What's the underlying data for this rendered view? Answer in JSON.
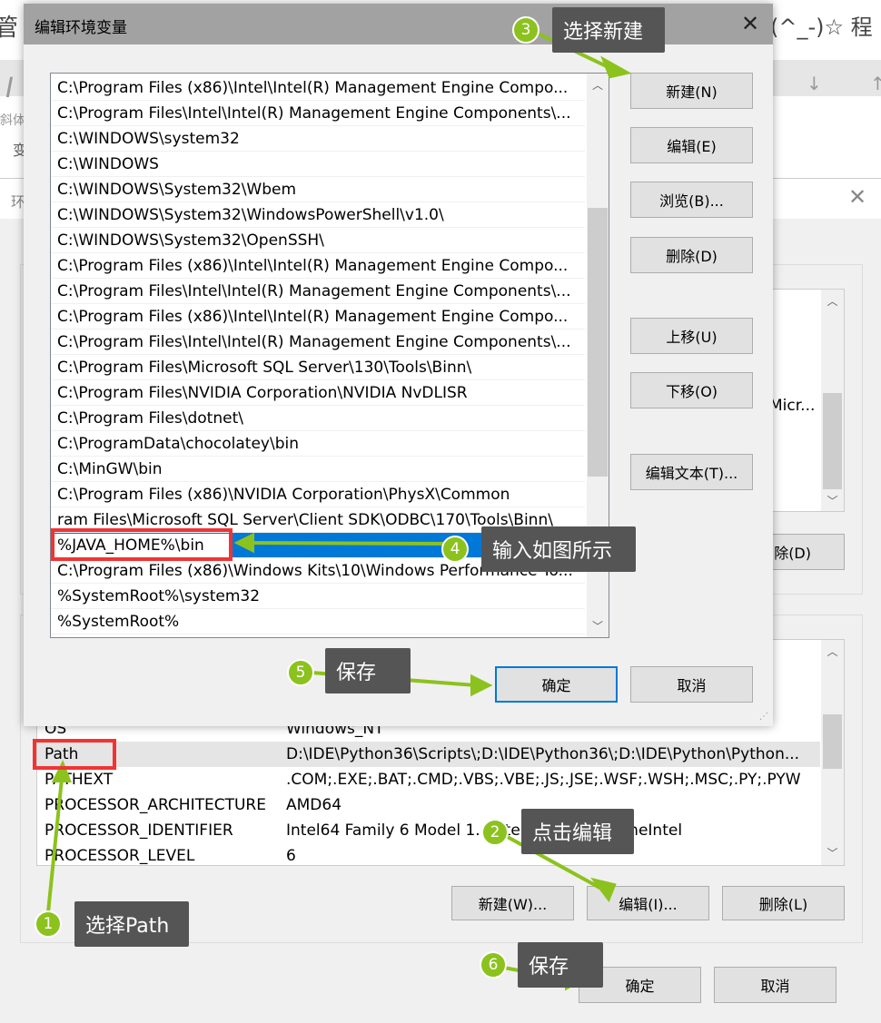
{
  "background": {
    "left_char": "管",
    "italic_char": "I",
    "italic_label": "斜体",
    "right_text": "(^_-)☆ 程",
    "side_char": "变"
  },
  "env_dialog": {
    "title_char": "环",
    "user_delete": "除(D)",
    "user_partial": "Micr...",
    "system_rows": [
      {
        "name": "OS",
        "value": "Windows_NT"
      },
      {
        "name": "Path",
        "value": "D:\\IDE\\Python36\\Scripts\\;D:\\IDE\\Python36\\;D:\\IDE\\Python\\Python..."
      },
      {
        "name": "PATHEXT",
        "value": ".COM;.EXE;.BAT;.CMD;.VBS;.VBE;.JS;.JSE;.WSF;.WSH;.MSC;.PY;.PYW"
      },
      {
        "name": "PROCESSOR_ARCHITECTURE",
        "value": "AMD64"
      },
      {
        "name": "PROCESSOR_IDENTIFIER",
        "value": "Intel64 Family 6 Model 1... Stepping... GenuineIntel"
      },
      {
        "name": "PROCESSOR_LEVEL",
        "value": "6"
      }
    ],
    "buttons": {
      "new": "新建(W)...",
      "edit": "编辑(I)...",
      "delete": "删除(L)",
      "ok": "确定",
      "cancel": "取消"
    }
  },
  "edit_dialog": {
    "title": "编辑环境变量",
    "paths": [
      "C:\\Program Files (x86)\\Intel\\Intel(R) Management Engine Compo...",
      "C:\\Program Files\\Intel\\Intel(R) Management Engine Components\\...",
      "C:\\WINDOWS\\system32",
      "C:\\WINDOWS",
      "C:\\WINDOWS\\System32\\Wbem",
      "C:\\WINDOWS\\System32\\WindowsPowerShell\\v1.0\\",
      "C:\\WINDOWS\\System32\\OpenSSH\\",
      "C:\\Program Files (x86)\\Intel\\Intel(R) Management Engine Compo...",
      "C:\\Program Files\\Intel\\Intel(R) Management Engine Components\\...",
      "C:\\Program Files (x86)\\Intel\\Intel(R) Management Engine Compo...",
      "C:\\Program Files\\Intel\\Intel(R) Management Engine Components\\...",
      "C:\\Program Files\\Microsoft SQL Server\\130\\Tools\\Binn\\",
      "C:\\Program Files\\NVIDIA Corporation\\NVIDIA NvDLISR",
      "C:\\Program Files\\dotnet\\",
      "C:\\ProgramData\\chocolatey\\bin",
      "C:\\MinGW\\bin",
      "C:\\Program Files (x86)\\NVIDIA Corporation\\PhysX\\Common",
      "ram Files\\Microsoft SQL Server\\Client SDK\\ODBC\\170\\Tools\\Binn\\",
      "%JAVA_HOME%\\bin",
      "C:\\Program Files (x86)\\Windows Kits\\10\\Windows Performance To...",
      "%SystemRoot%\\system32",
      "%SystemRoot%"
    ],
    "selected_index": 18,
    "buttons": {
      "new": "新建(N)",
      "edit": "编辑(E)",
      "browse": "浏览(B)...",
      "delete": "删除(D)",
      "up": "上移(U)",
      "down": "下移(O)",
      "edit_text": "编辑文本(T)...",
      "ok": "确定",
      "cancel": "取消"
    }
  },
  "annotations": [
    {
      "num": "1",
      "text": "选择Path"
    },
    {
      "num": "2",
      "text": "点击编辑"
    },
    {
      "num": "3",
      "text": "选择新建"
    },
    {
      "num": "4",
      "text": "输入如图所示"
    },
    {
      "num": "5",
      "text": "保存"
    },
    {
      "num": "6",
      "text": "保存"
    }
  ],
  "colors": {
    "accent": "#0078d7",
    "annotation_green": "#8cc21d",
    "annotation_bg": "#555555",
    "highlight_red": "#f03434"
  }
}
